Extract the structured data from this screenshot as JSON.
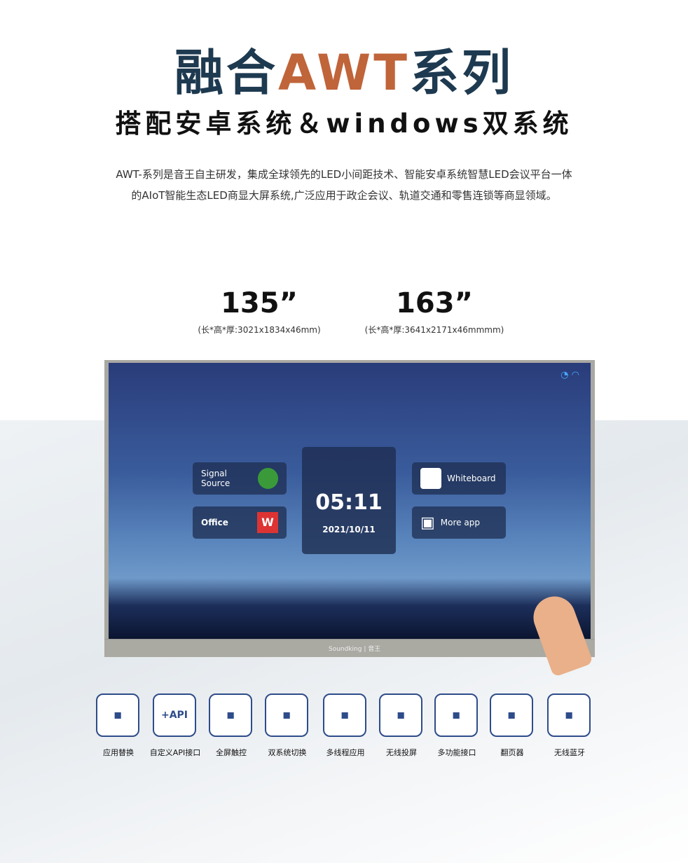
{
  "header": {
    "title_prefix": "融合",
    "title_accent": "AWT",
    "title_suffix": "系列",
    "subtitle": "搭配安卓系统＆windows双系统"
  },
  "description": [
    "AWT-系列是音王自主研发，集成全球领先的LED小间距技术、智能安卓系统智慧LED会议平台一体",
    "的AIoT智能生态LED商显大屏系统,广泛应用于政企会议、轨道交通和零售连锁等商显领域。"
  ],
  "sizes": [
    {
      "size": "135”",
      "dims": "(长*高*厚:3021x1834x46mm)"
    },
    {
      "size": "163”",
      "dims": "(长*高*厚:3641x2171x46mmmm)"
    }
  ],
  "screen": {
    "tiles": [
      "Signal Source",
      "Office",
      "Whiteboard",
      "More app"
    ],
    "time": "05:11",
    "date": "2021/10/11",
    "brand": "Soundking | 音王"
  },
  "features": [
    {
      "label": "应用替换",
      "icon": "app-replace-icon"
    },
    {
      "label": "自定义API接口",
      "icon_text": "+API"
    },
    {
      "label": "全屏触控",
      "icon": "touch-icon"
    },
    {
      "label": "双系统切换",
      "icon": "windows-android-icon"
    },
    {
      "label": "多线程应用",
      "icon": "multi-app-icon"
    },
    {
      "label": "无线投屏",
      "icon": "wireless-cast-icon"
    },
    {
      "label": "多功能接口",
      "icon": "ports-icon"
    },
    {
      "label": "翻页器",
      "icon": "pager-icon"
    },
    {
      "label": "无线蓝牙",
      "icon": "bluetooth-icon"
    }
  ],
  "colors": {
    "title": "#1e3a50",
    "accent": "#c0643a",
    "feature_border": "#2e4c8a"
  }
}
